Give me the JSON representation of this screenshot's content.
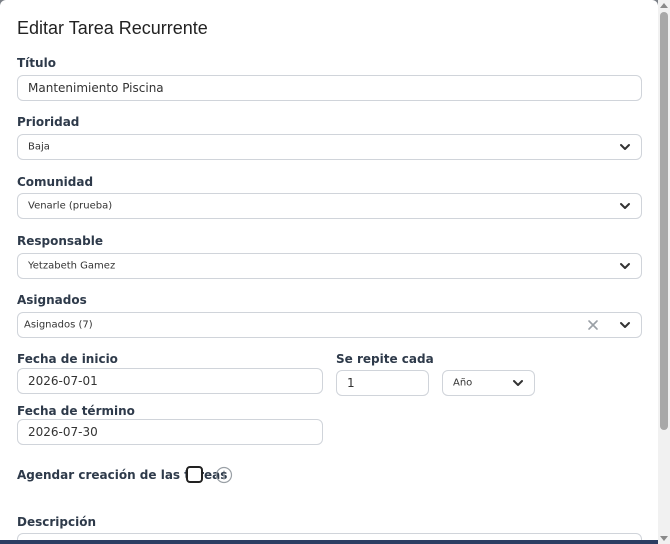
{
  "dialog": {
    "title": "Editar Tarea Recurrente"
  },
  "fields": {
    "titulo": {
      "label": "Título",
      "value": "Mantenimiento Piscina"
    },
    "prioridad": {
      "label": "Prioridad",
      "value": "Baja"
    },
    "comunidad": {
      "label": "Comunidad",
      "value": "Venarle (prueba)"
    },
    "responsable": {
      "label": "Responsable",
      "value": "Yetzabeth Gamez"
    },
    "asignados": {
      "label": "Asignados",
      "value": "Asignados (7)"
    },
    "fecha_inicio": {
      "label": "Fecha de inicio",
      "value": "2026-07-01"
    },
    "repite": {
      "label": "Se repite cada",
      "value": "1",
      "unit": "Año"
    },
    "fecha_termino": {
      "label": "Fecha de término",
      "value": "2026-07-30"
    },
    "agendar": {
      "label": "Agendar creación de las tareas",
      "checked": false
    },
    "descripcion": {
      "label": "Descripción"
    }
  },
  "icons": {
    "chevron": "chevron-down-icon",
    "clear": "close-icon",
    "info": "info-icon"
  },
  "colors": {
    "text": "#222222",
    "label": "#2e3a4a",
    "border": "#d0d4da",
    "overlay": "#7a7f86"
  }
}
